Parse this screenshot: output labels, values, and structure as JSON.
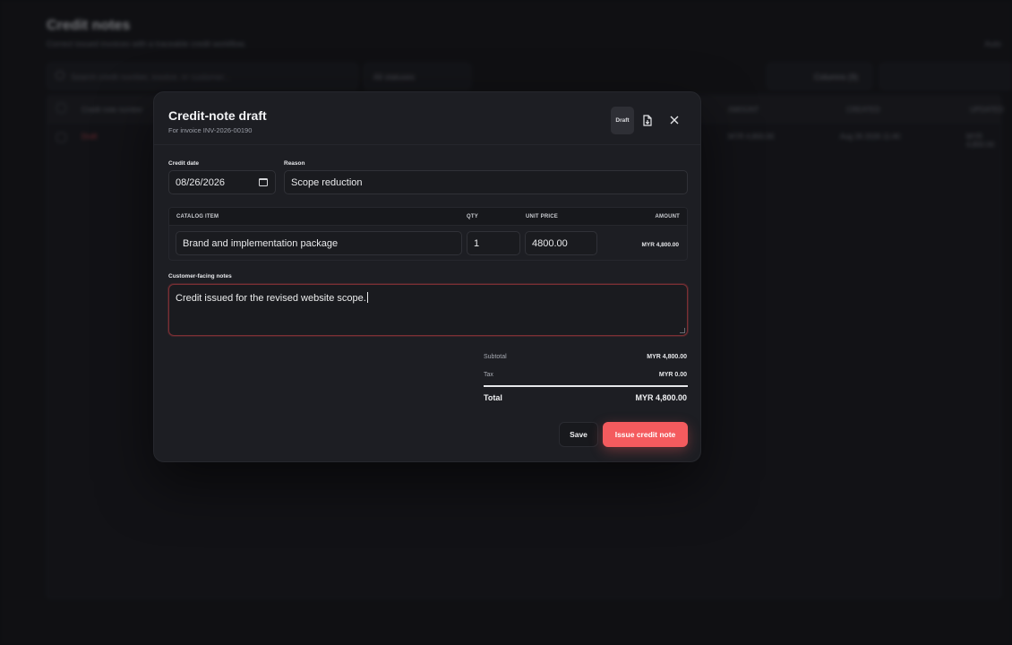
{
  "background": {
    "title": "Credit notes",
    "subtitle": "Correct issued invoices with a traceable credit workflow.",
    "right_link": "Auto",
    "search_placeholder": "Search credit number, invoice, or customer...",
    "status_filter": "All statuses",
    "columns_button": "Columns (9)",
    "table_headers": [
      "Credit note number",
      "AMOUNT",
      "CREATED",
      "UPDATED"
    ],
    "row": {
      "status": "Draft",
      "amount": "MYR 4,800.00",
      "created": "Aug 26 2026 11:40",
      "updated": "MYR 4,800.00"
    }
  },
  "modal": {
    "title": "Credit-note draft",
    "subtitle": "For invoice INV-2026-00190",
    "status_badge": "Draft",
    "export_icon": "file-export-icon",
    "close_icon": "close-icon",
    "credit_date": {
      "label": "Credit date",
      "value": "08/26/2026"
    },
    "reason": {
      "label": "Reason",
      "value": "Scope reduction"
    },
    "line_items": {
      "headers": {
        "item": "CATALOG ITEM",
        "qty": "QTY",
        "unit_price": "UNIT PRICE",
        "amount": "AMOUNT"
      },
      "rows": [
        {
          "item": "Brand and implementation package",
          "qty": "1",
          "unit_price": "4800.00",
          "amount": "MYR 4,800.00"
        }
      ]
    },
    "notes": {
      "label": "Customer-facing notes",
      "value": "Credit issued for the revised website scope."
    },
    "totals": {
      "subtotal_label": "Subtotal",
      "subtotal_value": "MYR 4,800.00",
      "tax_label": "Tax",
      "tax_value": "MYR 0.00",
      "total_label": "Total",
      "total_value": "MYR 4,800.00"
    },
    "actions": {
      "save": "Save",
      "issue": "Issue credit note"
    },
    "accent_color": "#f45b5e"
  }
}
